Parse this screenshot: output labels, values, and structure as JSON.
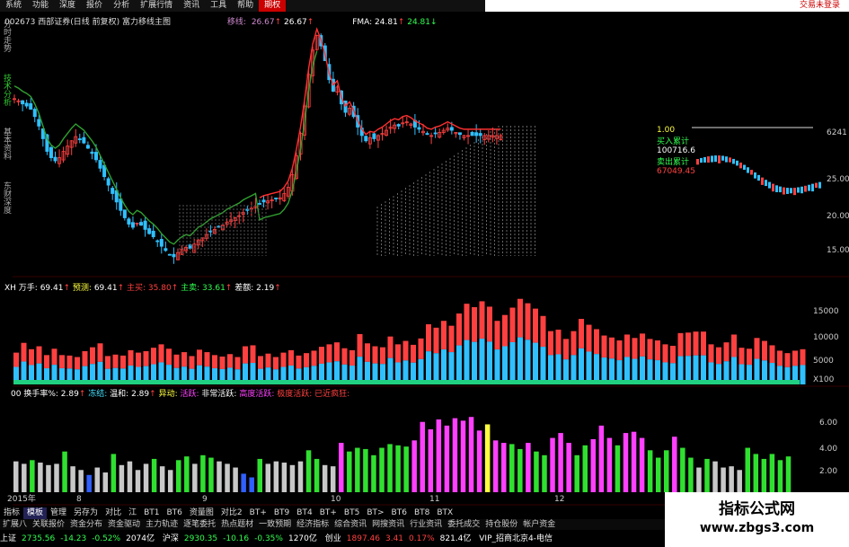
{
  "menu": {
    "items": [
      "系统",
      "功能",
      "深度",
      "报价",
      "分析",
      "扩展行情",
      "资讯",
      "工具",
      "帮助",
      "期权"
    ],
    "active_index": 9,
    "right_label": "交易未登录"
  },
  "left_tabs": [
    "分时走势",
    "技术分析",
    "基本资料",
    "东财深度"
  ],
  "chart_header": {
    "code": "002673",
    "name": "西部证券(日线 前复权)",
    "formula": "富力移线主图",
    "ma_label": "移线:",
    "ma_val1": "26.67",
    "ma_val2": "26.67",
    "fma_label": "FMA:",
    "fma_val1": "24.81",
    "fma_val2": "24.81"
  },
  "indicator1": {
    "name": "XH 万手:",
    "v1": "69.41",
    "forecast_label": "预测:",
    "forecast": "69.41",
    "buy_label": "主买:",
    "buy": "35.80",
    "sell_label": "主卖:",
    "sell": "33.61",
    "diff_label": "差额:",
    "diff": "2.19"
  },
  "indicator2": {
    "name": "00 换手率%:",
    "v1": "2.89",
    "frozen": "冻结:",
    "warm_label": "温和:",
    "warm": "2.89",
    "move": "异动:",
    "active": "活跃:",
    "very_active": "非常活跃:",
    "over_active": "高度活跃:",
    "extreme": "极度活跃:",
    "crazy": "已近疯狂:"
  },
  "y_axis_price": [
    "25.00",
    "20.00",
    "15.00"
  ],
  "y_axis_vol": [
    "15000",
    "10000",
    "5000",
    "X100"
  ],
  "y_axis_turn": [
    "6.00",
    "4.00",
    "2.00"
  ],
  "mini_panel": {
    "price": "6241",
    "v1": "1.00",
    "buy_label": "买入累计",
    "buy_val": "100716.6",
    "sell_label": "卖出累计",
    "sell_val": "67049.45"
  },
  "x_dates": [
    "2015年",
    "8",
    "9",
    "10",
    "11",
    "12"
  ],
  "bottom_tabs": [
    "指标",
    "模板",
    "管理",
    "另存为",
    "对比",
    "江",
    "BT1",
    "BT6",
    "资量图",
    "对比2",
    "BT+",
    "BT9",
    "BT4",
    "BT+",
    "BT5",
    "BT>",
    "BT6",
    "BT8",
    "BTX"
  ],
  "bottom_tabs_selected": 1,
  "bottom_menu": [
    "扩展八",
    "关联报价",
    "资金分布",
    "资金驱动",
    "主力轨迹",
    "逐笔委托",
    "热点题材",
    "一致预期",
    "经济指标",
    "综合资讯",
    "网搜资讯",
    "行业资讯",
    "委托成交",
    "持仓股份",
    "帐户资金"
  ],
  "status": {
    "sh_label": "上证",
    "sh_val": "2735.56",
    "sh_chg": "-14.23",
    "sh_pct": "-0.52%",
    "sh_amt": "2074亿",
    "sz_label": "沪深",
    "sz_val": "2930.35",
    "sz_chg": "-10.16",
    "sz_pct": "-0.35%",
    "sz_amt": "1270亿",
    "cy_label": "创业",
    "cy_val": "1897.46",
    "cy_chg": "3.41",
    "cy_pct": "0.17%",
    "cy_amt": "821.4亿",
    "server": "VIP_招商北京4-电信"
  },
  "watermark": {
    "line1": "指标公式网",
    "line2": "www.zbgs3.com"
  },
  "colors": {
    "up": "#ff4040",
    "down": "#30c0ff",
    "ma": "#ff3030",
    "fma": "#30a030",
    "hist_white": "#c8c8c8",
    "hist_green": "#30e030",
    "hist_magenta": "#ff40ff",
    "hist_yellow": "#ffff40",
    "hist_blue": "#3060ff"
  },
  "chart_data": [
    {
      "type": "candlestick",
      "x": [
        0,
        1,
        2,
        3,
        4,
        5,
        6,
        7,
        8,
        9,
        10,
        11,
        12,
        13,
        14,
        15,
        16,
        17,
        18,
        19,
        20,
        21,
        22,
        23,
        24,
        25,
        26,
        27,
        28,
        29,
        30,
        31,
        32,
        33,
        34,
        35,
        36,
        37,
        38,
        39,
        40,
        41,
        42,
        43,
        44,
        45,
        46,
        47,
        48,
        49,
        50,
        51,
        52,
        53,
        54,
        55,
        56,
        57,
        58,
        59,
        60,
        61,
        62,
        63,
        64,
        65,
        66,
        67,
        68,
        69,
        70,
        71,
        72,
        73,
        74,
        75,
        76,
        77,
        78,
        79,
        80,
        81,
        82,
        83,
        84,
        85,
        86,
        87,
        88,
        89,
        90,
        91,
        92,
        93,
        94,
        95,
        96,
        97,
        98,
        99,
        100,
        101,
        102,
        103,
        104,
        105,
        106,
        107,
        108,
        109,
        110,
        111,
        112,
        113,
        114,
        115,
        116,
        117,
        118,
        119
      ],
      "close": [
        30.2,
        30.0,
        29.7,
        29.5,
        29.2,
        28.5,
        27.6,
        26.4,
        25.2,
        24.6,
        24.3,
        24.6,
        25.2,
        25.7,
        26.2,
        26.6,
        26.3,
        26.0,
        25.5,
        25.0,
        24.4,
        23.6,
        22.8,
        22.0,
        21.2,
        20.4,
        19.6,
        18.9,
        18.3,
        18.0,
        18.4,
        18.2,
        17.8,
        17.4,
        17.1,
        16.7,
        16.2,
        15.8,
        15.4,
        15.2,
        15.6,
        15.9,
        16.1,
        16.0,
        16.4,
        16.8,
        17.0,
        17.3,
        17.6,
        17.8,
        18.0,
        18.2,
        18.5,
        18.7,
        18.9,
        19.1,
        19.4,
        19.6,
        19.8,
        20.0,
        20.2,
        20.4,
        20.5,
        20.6,
        20.7,
        20.8,
        21.2,
        21.8,
        23.0,
        24.8,
        26.9,
        29.5,
        32.5,
        34.8,
        36.2,
        35.2,
        33.8,
        32.0,
        30.9,
        31.3,
        29.7,
        28.9,
        29.3,
        28.5,
        27.5,
        26.7,
        26.2,
        26.5,
        26.4,
        26.7,
        26.9,
        27.2,
        27.5,
        27.7,
        27.6,
        27.9,
        28.0,
        27.8,
        27.5,
        27.3,
        27.1,
        26.8,
        26.7,
        26.9,
        27.0,
        27.2,
        27.4,
        27.2,
        27.0,
        26.8,
        26.7,
        26.7,
        26.7,
        26.7,
        26.7,
        26.7,
        26.7,
        26.7,
        26.7,
        26.7
      ],
      "ylim": [
        14,
        37
      ],
      "series": [
        {
          "name": "移线"
        },
        {
          "name": "FMA"
        }
      ]
    },
    {
      "type": "bar",
      "name": "XH 万手",
      "values": [
        6.5,
        8.5,
        7.2,
        7.8,
        6.0,
        7.3,
        6.0,
        5.9,
        5.6,
        6.8,
        7.6,
        8.4,
        5.8,
        6.1,
        5.9,
        7.0,
        6.5,
        6.8,
        7.5,
        8.2,
        7.3,
        6.1,
        6.6,
        5.8,
        7.1,
        6.6,
        6.0,
        5.7,
        6.2,
        5.6,
        7.8,
        8.0,
        5.8,
        6.3,
        5.6,
        6.5,
        7.0,
        5.9,
        6.4,
        6.9,
        7.7,
        8.2,
        8.6,
        7.4,
        7.0,
        10.3,
        8.4,
        7.8,
        7.6,
        9.8,
        8.2,
        8.9,
        8.1,
        9.4,
        12.3,
        11.6,
        13.0,
        12.0,
        14.5,
        16.5,
        15.8,
        17.0,
        15.9,
        13.0,
        14.2,
        15.7,
        17.5,
        16.6,
        15.5,
        14.0,
        10.9,
        11.2,
        9.3,
        10.9,
        13.4,
        12.2,
        11.3,
        10.0,
        9.6,
        9.0,
        10.2,
        9.5,
        10.4,
        9.3,
        9.0,
        8.2,
        7.9,
        10.5,
        10.6,
        10.8,
        10.8,
        8.2,
        7.6,
        8.6,
        10.2,
        7.5,
        7.3,
        9.5,
        8.9,
        8.0,
        6.9,
        6.4,
        6.9,
        7.2
      ],
      "ylim": [
        0,
        18000
      ]
    },
    {
      "type": "bar",
      "name": "换手率%",
      "values": [
        2.5,
        2.3,
        2.6,
        2.4,
        2.2,
        2.3,
        3.3,
        2.1,
        1.8,
        1.4,
        2.0,
        1.6,
        3.1,
        2.2,
        2.5,
        1.8,
        2.3,
        2.7,
        2.1,
        1.8,
        2.6,
        2.9,
        2.3,
        3.0,
        2.8,
        2.5,
        2.3,
        2.0,
        1.5,
        1.2,
        2.7,
        2.3,
        2.5,
        2.4,
        2.2,
        2.5,
        3.4,
        2.7,
        2.2,
        2.1,
        4.0,
        3.3,
        3.6,
        3.5,
        3.0,
        3.6,
        3.9,
        3.8,
        3.7,
        4.2,
        5.7,
        5.1,
        5.9,
        5.4,
        6.0,
        5.8,
        6.1,
        5.0,
        5.5,
        4.2,
        4.0,
        3.9,
        3.5,
        4.0,
        3.3,
        3.0,
        4.4,
        4.8,
        4.0,
        3.0,
        3.8,
        4.3,
        5.4,
        4.4,
        3.8,
        4.8,
        4.9,
        4.4,
        3.4,
        2.8,
        3.4,
        4.5,
        3.6,
        2.8,
        2.0,
        2.7,
        2.5,
        2.0,
        2.1,
        1.8,
        3.6,
        3.1,
        2.7,
        3.1,
        2.6,
        2.9
      ],
      "ylim": [
        0,
        7.5
      ]
    }
  ]
}
